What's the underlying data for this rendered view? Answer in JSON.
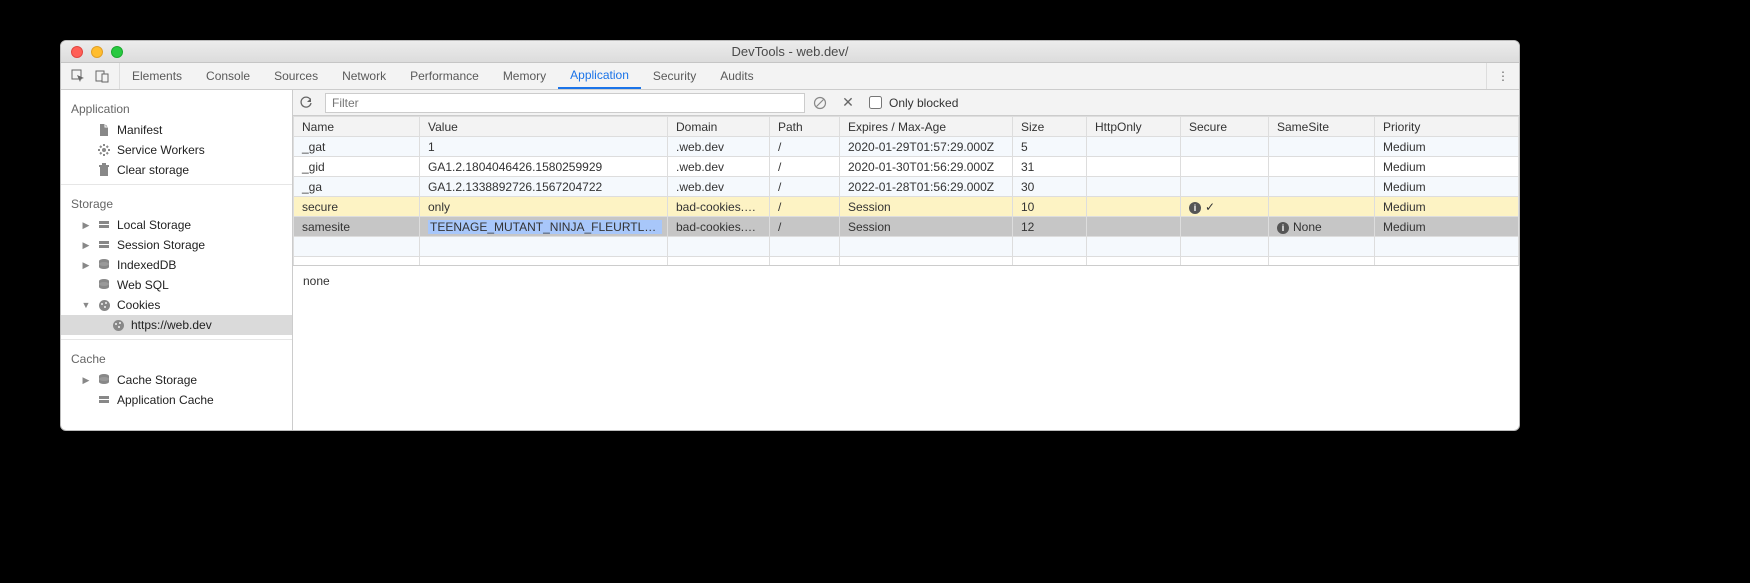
{
  "window": {
    "title": "DevTools - web.dev/"
  },
  "tabs": {
    "items": [
      "Elements",
      "Console",
      "Sources",
      "Network",
      "Performance",
      "Memory",
      "Application",
      "Security",
      "Audits"
    ],
    "active_index": 6
  },
  "sidebar": {
    "sections": {
      "application": {
        "title": "Application",
        "items": [
          {
            "label": "Manifest",
            "icon": "file"
          },
          {
            "label": "Service Workers",
            "icon": "gear"
          },
          {
            "label": "Clear storage",
            "icon": "trash"
          }
        ]
      },
      "storage": {
        "title": "Storage",
        "items": [
          {
            "label": "Local Storage",
            "icon": "db",
            "expandable": true,
            "expanded": false
          },
          {
            "label": "Session Storage",
            "icon": "db",
            "expandable": true,
            "expanded": false
          },
          {
            "label": "IndexedDB",
            "icon": "dbstack",
            "expandable": true,
            "expanded": false
          },
          {
            "label": "Web SQL",
            "icon": "dbstack",
            "expandable": false
          },
          {
            "label": "Cookies",
            "icon": "cookie",
            "expandable": true,
            "expanded": true,
            "children": [
              {
                "label": "https://web.dev",
                "icon": "cookie",
                "selected": true
              }
            ]
          }
        ]
      },
      "cache": {
        "title": "Cache",
        "items": [
          {
            "label": "Cache Storage",
            "icon": "dbstack",
            "expandable": true,
            "expanded": false
          },
          {
            "label": "Application Cache",
            "icon": "db",
            "expandable": false
          }
        ]
      }
    }
  },
  "toolbar": {
    "filter_placeholder": "Filter",
    "only_blocked_label": "Only blocked"
  },
  "table": {
    "columns": [
      "Name",
      "Value",
      "Domain",
      "Path",
      "Expires / Max-Age",
      "Size",
      "HttpOnly",
      "Secure",
      "SameSite",
      "Priority"
    ],
    "rows": [
      {
        "name": "_gat",
        "value": "1",
        "domain": ".web.dev",
        "path": "/",
        "expires": "2020-01-29T01:57:29.000Z",
        "size": 5,
        "httpOnly": "",
        "secure": "",
        "sameSite": "",
        "priority": "Medium",
        "state": "even"
      },
      {
        "name": "_gid",
        "value": "GA1.2.1804046426.1580259929",
        "domain": ".web.dev",
        "path": "/",
        "expires": "2020-01-30T01:56:29.000Z",
        "size": 31,
        "httpOnly": "",
        "secure": "",
        "sameSite": "",
        "priority": "Medium",
        "state": "odd"
      },
      {
        "name": "_ga",
        "value": "GA1.2.1338892726.1567204722",
        "domain": ".web.dev",
        "path": "/",
        "expires": "2022-01-28T01:56:29.000Z",
        "size": 30,
        "httpOnly": "",
        "secure": "",
        "sameSite": "",
        "priority": "Medium",
        "state": "even"
      },
      {
        "name": "secure",
        "value": "only",
        "domain": "bad-cookies.g…",
        "path": "/",
        "expires": "Session",
        "size": 10,
        "httpOnly": "",
        "secure": "warn-check",
        "sameSite": "",
        "priority": "Medium",
        "state": "warn"
      },
      {
        "name": "samesite",
        "value": "TEENAGE_MUTANT_NINJA_FLEURTLES",
        "domain": "bad-cookies.g…",
        "path": "/",
        "expires": "Session",
        "size": 12,
        "httpOnly": "",
        "secure": "",
        "sameSite": "warn-none",
        "priority": "Medium",
        "state": "sel",
        "value_selected": true
      }
    ]
  },
  "detail": {
    "text": "none"
  }
}
